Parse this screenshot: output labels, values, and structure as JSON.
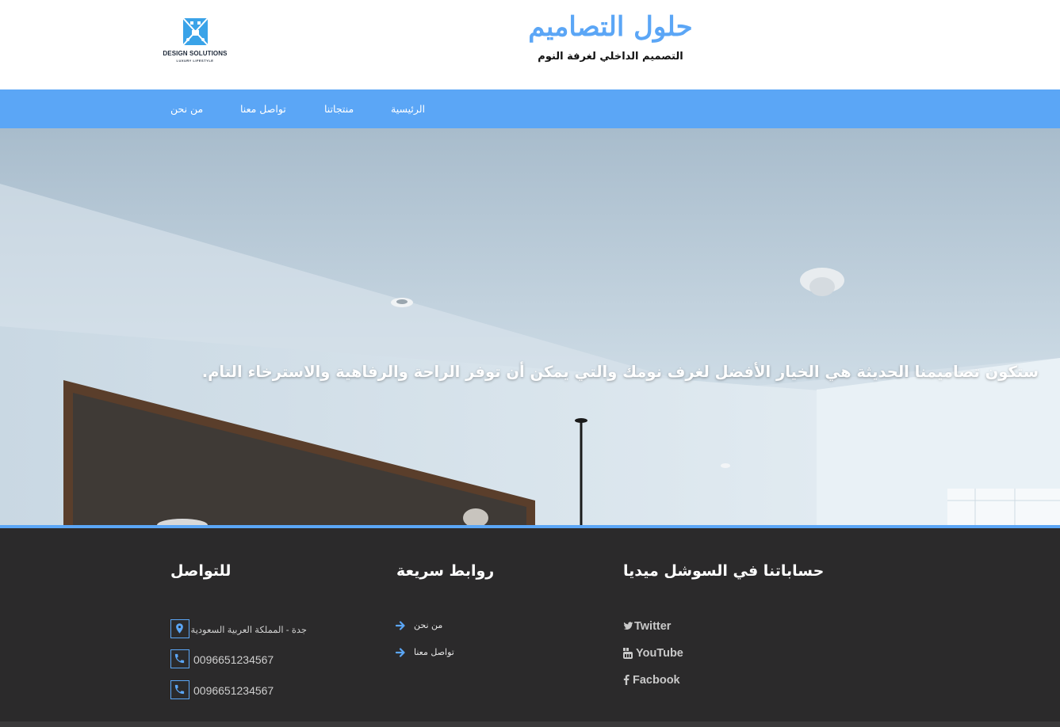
{
  "header": {
    "logo_text": "DESIGN SOLUTIONS",
    "logo_subtext": "LUXURY LIFESTYLE",
    "title": "حلول التصاميم",
    "subtitle": "التصميم الداخلي لغرفة النوم"
  },
  "nav": {
    "items": [
      {
        "label": "الرئيسية"
      },
      {
        "label": "منتجاتنا"
      },
      {
        "label": "تواصل معنا"
      },
      {
        "label": "من نحن"
      }
    ]
  },
  "hero": {
    "text": "ستكون تصاميمنا الحديثة هي الخيار الأفضل لغرف نومك والتي يمكن أن توفر الراحة والرفاهية والاسترخاء التام."
  },
  "footer": {
    "social": {
      "title": "حساباتنا في السوشل ميديا",
      "links": [
        {
          "label": "Twitter",
          "icon": "twitter-icon"
        },
        {
          "label": "YouTube",
          "icon": "youtube-icon"
        },
        {
          "label": "Facbook",
          "icon": "facebook-icon"
        }
      ]
    },
    "quick_links": {
      "title": "روابط سريعة",
      "links": [
        {
          "label": "من نحن",
          "icon": "arrow-right-icon"
        },
        {
          "label": "تواصل معنا",
          "icon": "arrow-right-icon"
        }
      ]
    },
    "contact": {
      "title": "للتواصل",
      "address": "جدة - المملكة العربية السعودية",
      "phone_1": "0096651234567",
      "phone_2": "0096651234567"
    }
  },
  "colors": {
    "accent": "#5ba6f6",
    "footer_bg": "#2b2a2b"
  }
}
